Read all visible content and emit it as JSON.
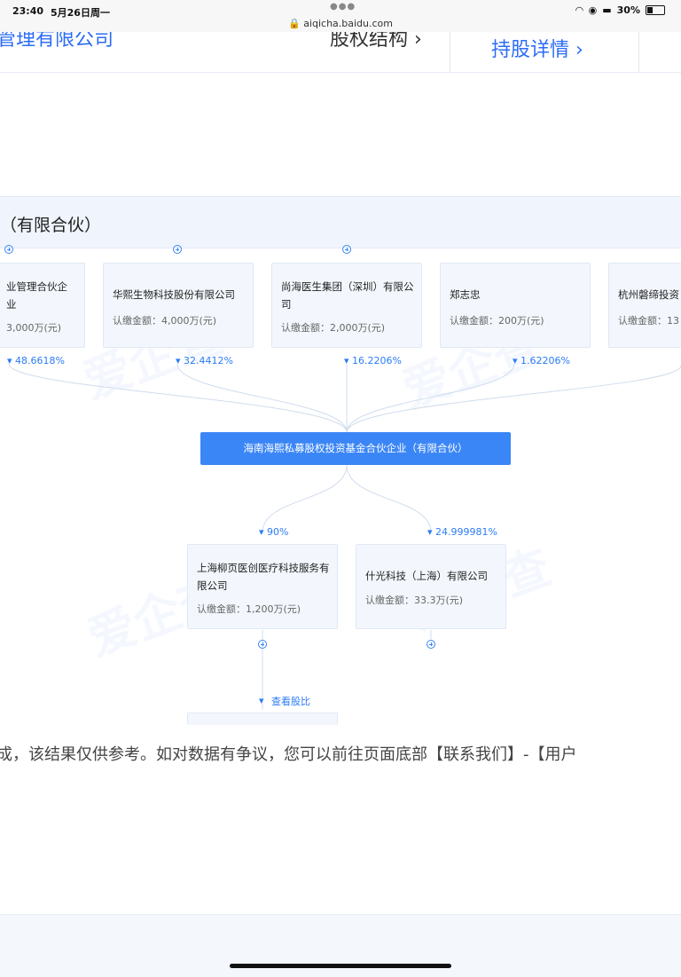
{
  "status_bar": {
    "time": "23:40",
    "date": "5月26日周一",
    "url": "aiqicha.baidu.com",
    "battery": "30%"
  },
  "top_band": {
    "left_title": "管理有限公司",
    "mid_title": "股权结构 ›",
    "right_title": "持股详情 ›"
  },
  "section": {
    "title": "（有限合伙）"
  },
  "watermark": "爱企查",
  "shareholders": [
    {
      "name": "业管理合伙企业",
      "amount": "3,000万(元)",
      "percent": "48.6618%"
    },
    {
      "name": "华熙生物科技股份有限公司",
      "amount": "认缴金额：4,000万(元)",
      "percent": "32.4412%"
    },
    {
      "name": "尚海医生集团（深圳）有限公司",
      "amount": "认缴金额：2,000万(元)",
      "percent": "16.2206%"
    },
    {
      "name": "郑志忠",
      "amount": "认缴金额：200万(元)",
      "percent": "1.62206%"
    },
    {
      "name": "杭州磐缔投资",
      "amount": "认缴金额：13"
    }
  ],
  "center_company": "海南海熙私募股权投资基金合伙企业（有限合伙）",
  "investments": [
    {
      "name": "上海柳页医创医疗科技服务有限公司",
      "amount": "认缴金额：1,200万(元)",
      "percent": "90%"
    },
    {
      "name": "什光科技（上海）有限公司",
      "amount": "认缴金额：33.3万(元)",
      "percent": "24.999981%"
    }
  ],
  "view_ratio_link": "查看股比",
  "footnote": "成，该结果仅供参考。如对数据有争议，您可以前往页面底部【联系我们】-【用户"
}
